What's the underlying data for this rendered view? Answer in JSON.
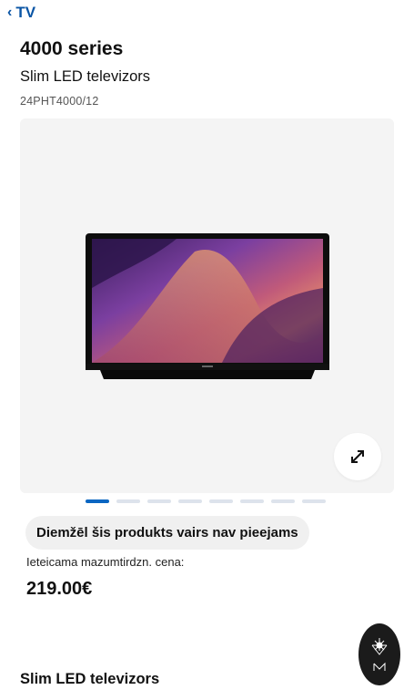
{
  "nav": {
    "back_label": "TV",
    "back_chevron": "‹"
  },
  "product": {
    "series": "4000 series",
    "name": "Slim LED televizors",
    "model": "24PHT4000/12"
  },
  "gallery": {
    "page_count": 8,
    "active_index": 0,
    "expand_icon": "expand-arrows-icon"
  },
  "availability": {
    "badge": "Diemžēl šis produkts vairs nav pieejams"
  },
  "pricing": {
    "label": "Ieteicama mazumtirdzn. cena:",
    "value": "219.00€"
  },
  "section": {
    "title": "Slim LED televizors"
  },
  "colors": {
    "accent": "#0a66c2",
    "link": "#0a55a5",
    "gallery_bg": "#f4f4f4",
    "badge_bg": "#f0f0f0"
  }
}
